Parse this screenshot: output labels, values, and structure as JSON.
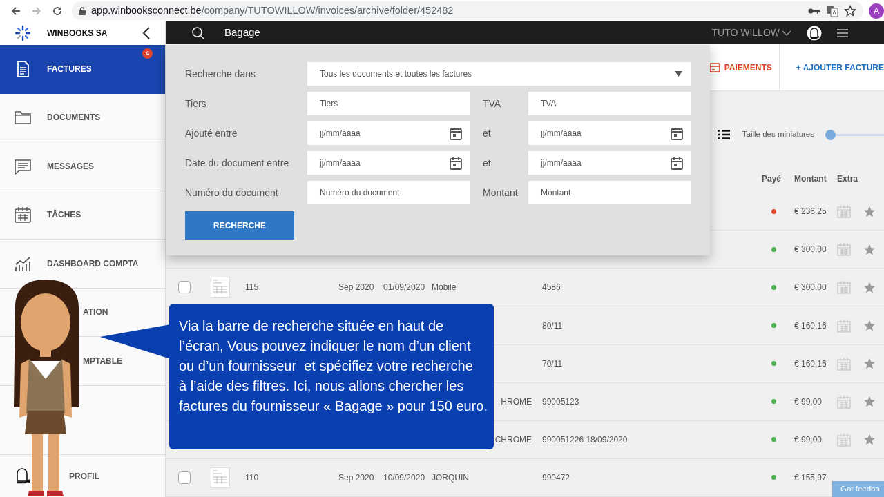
{
  "browser": {
    "url_host": "app.winbooksconnect.be",
    "url_path": "/company/TUTOWILLOW/invoices/archive/folder/452482",
    "profile_initial": "A"
  },
  "sidebar": {
    "company": "WINBOOKS SA",
    "items": [
      {
        "label": "FACTURES",
        "selected": true,
        "badge": "4"
      },
      {
        "label": "DOCUMENTS",
        "selected": false
      },
      {
        "label": "MESSAGES",
        "selected": false
      },
      {
        "label": "TÂCHES",
        "selected": false
      },
      {
        "label": "DASHBOARD COMPTA",
        "selected": false
      },
      {
        "label": "ATION",
        "selected": false
      },
      {
        "label": "MPTABLE",
        "selected": false
      },
      {
        "label": "PROFIL",
        "selected": false
      }
    ]
  },
  "header": {
    "search_value": "Bagage",
    "user": "TUTO WILLOW"
  },
  "actions": [
    {
      "label": "PAIEMENTS",
      "kind": "payments"
    },
    {
      "label": "+ AJOUTER FACTURE",
      "kind": "add"
    }
  ],
  "search_panel": {
    "rows": [
      {
        "fields": [
          {
            "label": "Recherche dans",
            "kind": "select",
            "value": "Tous les documents et toutes les factures"
          }
        ]
      },
      {
        "fields": [
          {
            "label": "Tiers",
            "kind": "text",
            "placeholder": "Tiers"
          },
          {
            "label": "TVA",
            "kind": "text",
            "placeholder": "TVA"
          }
        ]
      },
      {
        "fields": [
          {
            "label": "Ajouté entre",
            "kind": "date",
            "placeholder": "jj/mm/aaaa"
          },
          {
            "label": "et",
            "kind": "date",
            "placeholder": "jj/mm/aaaa"
          }
        ]
      },
      {
        "fields": [
          {
            "label": "Date du document entre",
            "kind": "date",
            "placeholder": "jj/mm/aaaa"
          },
          {
            "label": "et",
            "kind": "date",
            "placeholder": "jj/mm/aaaa"
          }
        ]
      },
      {
        "fields": [
          {
            "label": "Numéro du document",
            "kind": "text",
            "placeholder": "Numéro du document"
          },
          {
            "label": "Montant",
            "kind": "text",
            "placeholder": "Montant"
          }
        ]
      }
    ],
    "button": "RECHERCHE"
  },
  "toolbar": {
    "thumbnail_label": "Taille des miniatures",
    "thumbnail_slider": {
      "level": 0
    }
  },
  "table": {
    "headers": {
      "paid": "Payé",
      "amount": "Montant",
      "extra": "Extra"
    },
    "rows": [
      {
        "kind": "covered",
        "color": "#e0452b",
        "amount": "€ 236,25"
      },
      {
        "kind": "covered",
        "color": "#4caf50",
        "amount": "€ 300,00"
      },
      {
        "kind": "full",
        "checked": false,
        "number": "115",
        "period": "Sep 2020",
        "date": "01/09/2020",
        "tiers": "Mobile",
        "reference": "4586",
        "color": "#4caf50",
        "amount": "€ 300,00"
      },
      {
        "kind": "covered",
        "reference": "80/11",
        "color": "#4caf50",
        "amount": "€ 160,16"
      },
      {
        "kind": "covered",
        "reference": "70/11",
        "color": "#4caf50",
        "amount": "€ 160,16"
      },
      {
        "kind": "covered",
        "tiers": "HROME",
        "reference": "99005123",
        "color": "#4caf50",
        "amount": "€ 99,00"
      },
      {
        "kind": "covered",
        "tiers": "CHROME",
        "reference": "990051226 18/09/2020",
        "color": "#4caf50",
        "amount": "€ 99,00"
      },
      {
        "kind": "full",
        "checked": false,
        "number": "110",
        "period": "Sep 2020",
        "date": "10/09/2020",
        "tiers": "JORQUIN",
        "reference": "990472",
        "color": "#4caf50",
        "amount": "€ 155,97"
      }
    ]
  },
  "tutorial": {
    "caption": "Via la barre de recherche située en haut de\nl’écran, Vous pouvez indiquer le nom d’un client\nou d’un fournisseur  et spécifiez votre recherche\nà l’aide des filtres. Ici, nous allons chercher les\nfactures du fournisseur « Bagage » pour 150 euro."
  },
  "feedback_button": "Got feedba"
}
